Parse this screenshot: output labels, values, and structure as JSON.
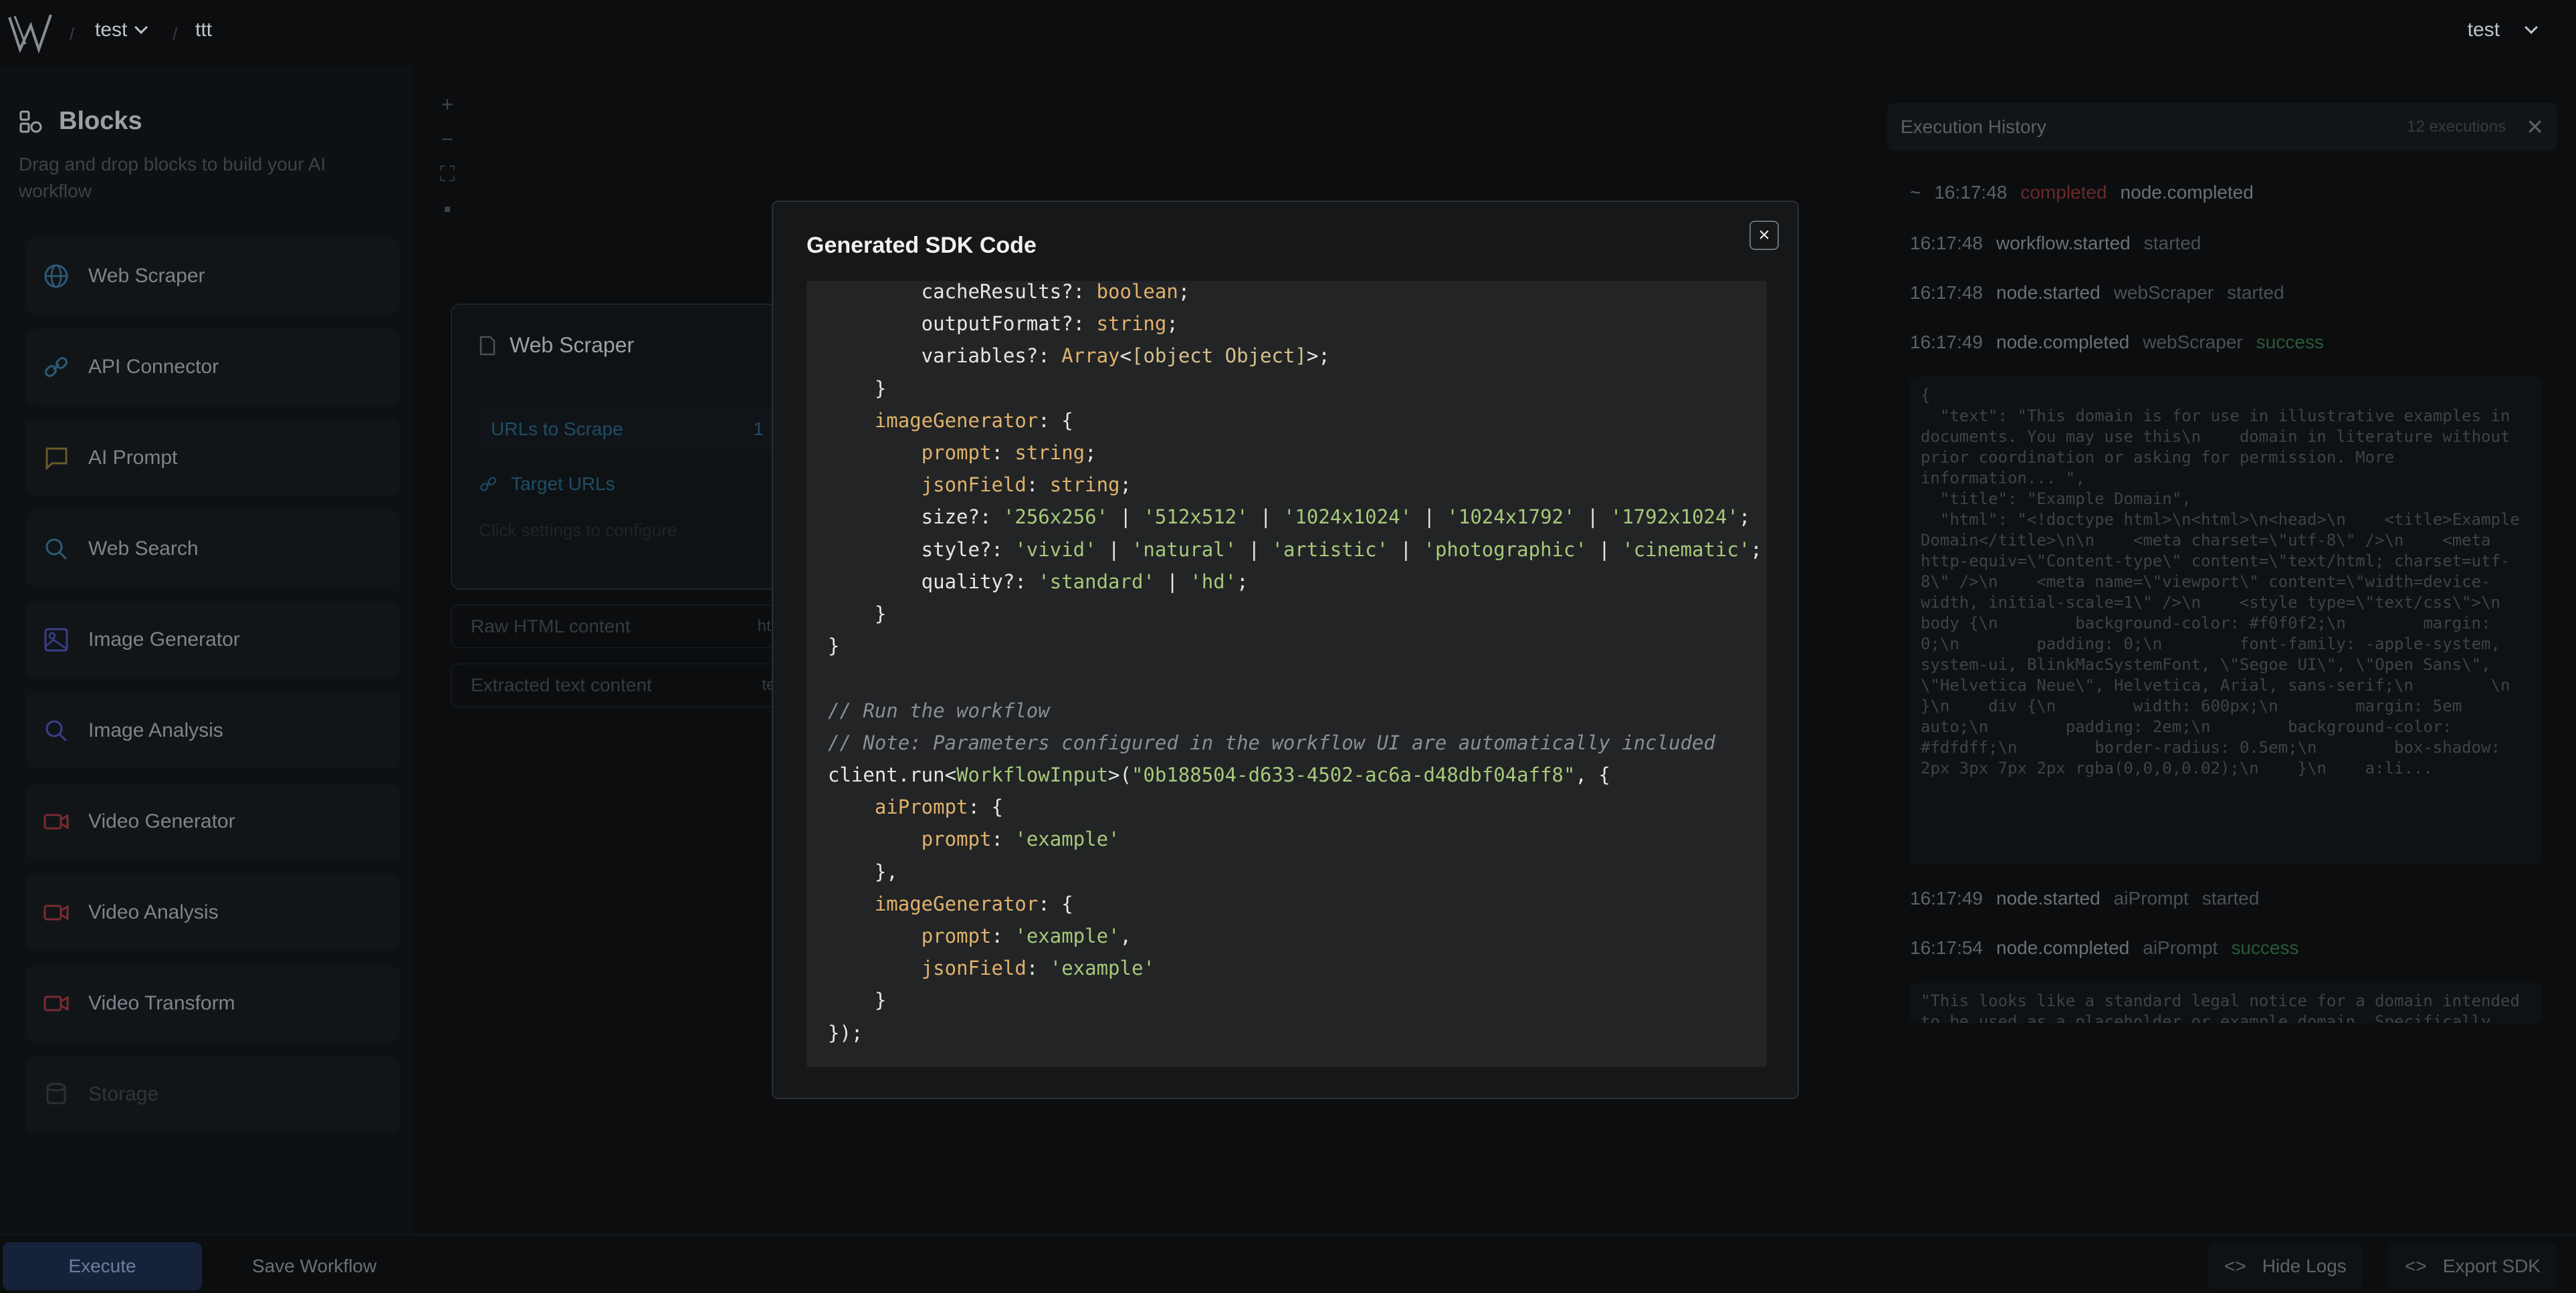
{
  "breadcrumb": {
    "project": "test",
    "workflow": "ttt"
  },
  "user": {
    "name": "test"
  },
  "sidebar": {
    "title": "Blocks",
    "subtitle": "Drag and drop blocks to build your AI workflow",
    "items": [
      {
        "label": "Web Scraper",
        "icon": "globe-icon"
      },
      {
        "label": "API Connector",
        "icon": "link-icon"
      },
      {
        "label": "AI Prompt",
        "icon": "message-icon"
      },
      {
        "label": "Web Search",
        "icon": "search-icon"
      },
      {
        "label": "Image Generator",
        "icon": "image-icon"
      },
      {
        "label": "Image Analysis",
        "icon": "search-icon"
      },
      {
        "label": "Video Generator",
        "icon": "video-icon"
      },
      {
        "label": "Video Analysis",
        "icon": "video-icon"
      },
      {
        "label": "Video Transform",
        "icon": "video-icon"
      },
      {
        "label": "Storage",
        "icon": "database-icon"
      }
    ]
  },
  "canvas": {
    "node": {
      "title": "Web Scraper",
      "field_label": "URLs to Scrape",
      "field_count": "1",
      "link_label": "Target URLs",
      "hint": "Click settings to configure"
    },
    "outputs": [
      {
        "label": "Raw HTML content",
        "tag": "html"
      },
      {
        "label": "Extracted text content",
        "tag": "text"
      }
    ]
  },
  "history": {
    "title": "Execution History",
    "count": "12 executions",
    "rows": [
      {
        "time": "16:17:48",
        "status": "completed",
        "event": "node.completed",
        "prefix": "~"
      },
      {
        "time": "16:17:48",
        "event": "workflow.started",
        "status": "started"
      },
      {
        "time": "16:17:48",
        "event": "node.started",
        "node": "webScraper",
        "status": "started"
      },
      {
        "time": "16:17:49",
        "event": "node.completed",
        "node": "webScraper",
        "status": "success"
      },
      {
        "time": "16:17:49",
        "event": "node.started",
        "node": "aiPrompt",
        "status": "started"
      },
      {
        "time": "16:17:54",
        "event": "node.completed",
        "node": "aiPrompt",
        "status": "success"
      }
    ],
    "block1": "{\n  \"text\": \"This domain is for use in illustrative examples in\ndocuments. You may use this\\n    domain in literature without\nprior coordination or asking for permission. More\ninformation... \",\n  \"title\": \"Example Domain\",\n  \"html\": \"<!doctype html>\\n<html>\\n<head>\\n    <title>Example\nDomain</title>\\n\\n    <meta charset=\\\"utf-8\\\" />\\n    <meta\nhttp-equiv=\\\"Content-type\\\" content=\\\"text/html; charset=utf-\n8\\\" />\\n    <meta name=\\\"viewport\\\" content=\\\"width=device-\nwidth, initial-scale=1\\\" />\\n    <style type=\\\"text/css\\\">\\n\nbody {\\n        background-color: #f0f0f2;\\n        margin:\n0;\\n        padding: 0;\\n        font-family: -apple-system,\nsystem-ui, BlinkMacSystemFont, \\\"Segoe UI\\\", \\\"Open Sans\\\",\n\\\"Helvetica Neue\\\", Helvetica, Arial, sans-serif;\\n        \\n\n}\\n    div {\\n        width: 600px;\\n        margin: 5em\nauto;\\n        padding: 2em;\\n        background-color:\n#fdfdff;\\n        border-radius: 0.5em;\\n        box-shadow:\n2px 3px 7px 2px rgba(0,0,0,0.02);\\n    }\\n    a:li...",
    "block2": "\"This looks like a standard legal notice for a domain intended\nto be used as a placeholder or example domain. Specifically,"
  },
  "bottom": {
    "execute": "Execute",
    "save": "Save Workflow",
    "hide_logs": "Hide Logs",
    "export_sdk": "Export SDK"
  },
  "modal": {
    "title": "Generated SDK Code",
    "close": "×"
  },
  "code": {
    "workflow_id": "\"0b188504-d633-4502-ac6a-d48dbf04aff8\"",
    "comment_run": "// Run the workflow",
    "comment_note": "// Note: Parameters configured in the workflow UI are automatically included"
  },
  "colors": {
    "background": "#0b0d0f",
    "modal_bg": "#151719",
    "code_bg": "#222426",
    "keyword": "#e0b26b",
    "string": "#a6c97a",
    "comment": "#8a8e93",
    "success": "#2a5a36",
    "error": "#6b2a2a"
  }
}
